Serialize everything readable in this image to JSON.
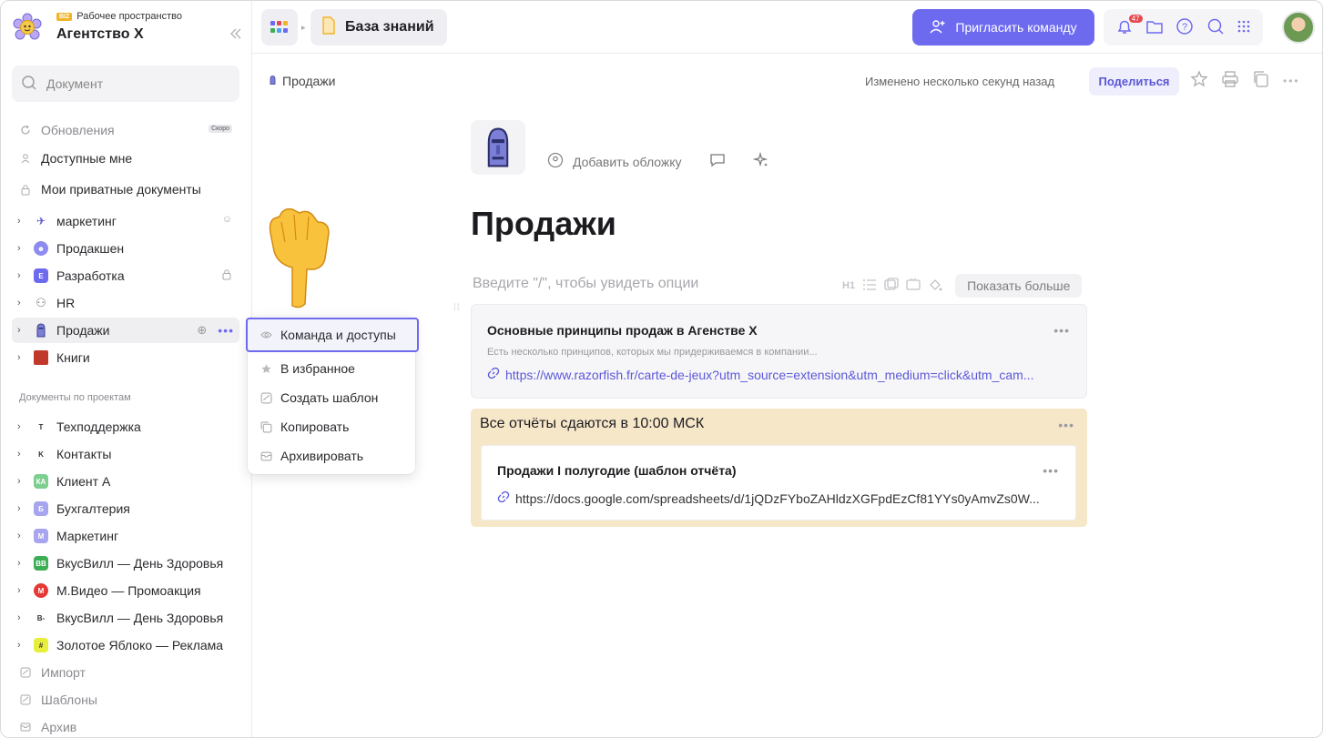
{
  "workspace": {
    "badge": "BIZ",
    "label": "Рабочее пространство",
    "name": "Агентство X"
  },
  "sidebar": {
    "search_placeholder": "Документ",
    "top_items": [
      {
        "label": "Обновления",
        "icon": "refresh-icon",
        "tag": "Скоро"
      },
      {
        "label": "Доступные мне",
        "icon": "person-icon"
      },
      {
        "label": "Мои приватные документы",
        "icon": "lock-icon"
      }
    ],
    "teams": [
      {
        "label": "маркетинг",
        "icon": "megaphone-icon"
      },
      {
        "label": "Продакшен",
        "icon": "globe-icon"
      },
      {
        "label": "Разработка",
        "icon": "code-icon"
      },
      {
        "label": "HR",
        "icon": "people-icon"
      },
      {
        "label": "Продажи",
        "icon": "moai-icon"
      },
      {
        "label": "Книги",
        "icon": "book-icon"
      }
    ],
    "projects_label": "Документы по проектам",
    "projects": [
      {
        "label": "Техподдержка",
        "badge": "T",
        "color": "#ffffff"
      },
      {
        "label": "Контакты",
        "badge": "K",
        "color": "#ffffff"
      },
      {
        "label": "Клиент А",
        "badge": "КА",
        "color": "#7ccf8f"
      },
      {
        "label": "Бухгалтерия",
        "badge": "Б",
        "color": "#a7a5f0"
      },
      {
        "label": "Маркетинг",
        "badge": "М",
        "color": "#a7a5f0"
      },
      {
        "label": "ВкусВилл — День Здоровья",
        "badge": "ВВ",
        "color": "#3dae54"
      },
      {
        "label": "М.Видео — Промоакция",
        "badge": "М",
        "color": "#e53935"
      },
      {
        "label": "ВкусВилл — День Здоровья",
        "badge": "В-",
        "color": "#ffffff"
      },
      {
        "label": "Золотое Яблоко — Реклама",
        "badge": "#",
        "color": "#e7ef3a"
      }
    ],
    "bottom_items": [
      {
        "label": "Импорт",
        "icon": "import-icon"
      },
      {
        "label": "Шаблоны",
        "icon": "templates-icon"
      },
      {
        "label": "Архив",
        "icon": "archive-icon"
      }
    ]
  },
  "topbar": {
    "knowledge_base": "База знаний",
    "invite": "Пригласить команду",
    "notifications_count": "47"
  },
  "doc": {
    "breadcrumb": "Продажи",
    "changed": "Изменено несколько секунд назад",
    "share": "Поделиться",
    "add_cover": "Добавить обложку",
    "title": "Продажи",
    "placeholder": "Введите \"/\", чтобы увидеть опции",
    "format_h1": "H1",
    "show_more": "Показать больше",
    "card": {
      "title": "Основные принципы продаж в Агенстве Х",
      "description": "Есть несколько принципов, которых мы придерживаемся в компании...",
      "link": "https://www.razorfish.fr/carte-de-jeux?utm_source=extension&utm_medium=click&utm_cam..."
    },
    "callout": {
      "title": "Все отчёты сдаются в 10:00 МСК",
      "card_title": "Продажи I полугодие (шаблон отчёта)",
      "card_link": "https://docs.google.com/spreadsheets/d/1jQDzFYboZAHldzXGFpdEzCf81YYs0yAmvZs0W..."
    }
  },
  "context_menu": {
    "items": [
      {
        "label": "Команда и доступы",
        "icon": "eye-icon"
      },
      {
        "label": "В избранное",
        "icon": "star-icon"
      },
      {
        "label": "Создать шаблон",
        "icon": "template-icon"
      },
      {
        "label": "Копировать",
        "icon": "copy-icon"
      },
      {
        "label": "Архивировать",
        "icon": "archive-icon"
      }
    ]
  },
  "colors": {
    "accent": "#6d6af0",
    "callout_bg": "#f7e7c9",
    "link": "#5b58d8"
  }
}
